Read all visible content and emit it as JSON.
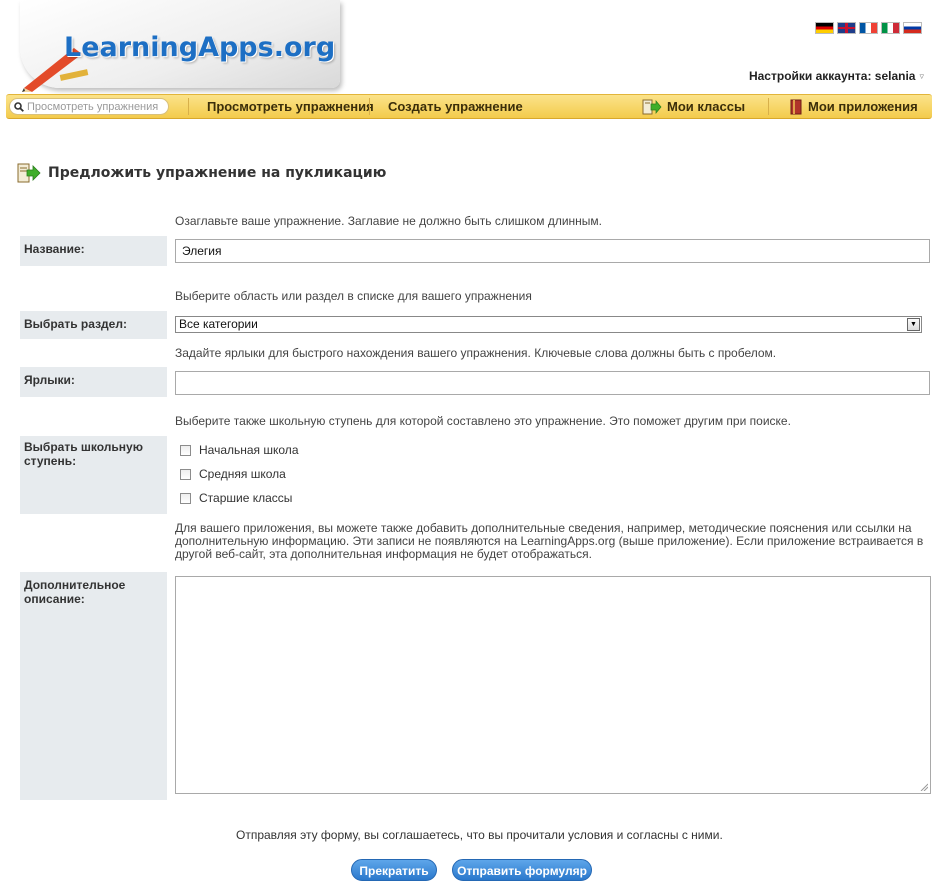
{
  "header": {
    "logo_text": "LearningApps.org",
    "account_label": "Настройки аккаунта: selania",
    "languages": [
      "de",
      "en",
      "fr",
      "it",
      "ru"
    ]
  },
  "nav": {
    "search_placeholder": "Просмотреть упражнения",
    "browse": "Просмотреть упражнения",
    "create": "Создать упражнение",
    "my_classes": "Мои классы",
    "my_apps": "Мои приложения"
  },
  "page": {
    "title": "Предложить упражнение на пукликацию"
  },
  "form": {
    "title_hint": "Озаглавьте ваше упражнение. Заглавие не должно быть слишком длинным.",
    "title_label": "Название:",
    "title_value": "Элегия",
    "category_hint": "Выберите область или раздел в списке для вашего упражнения",
    "category_label": "Выбрать раздел:",
    "category_value": "Все категории",
    "tags_hint": "Задайте ярлыки для быстрого нахождения вашего упражнения. Ключевые слова должны быть с пробелом.",
    "tags_label": "Ярлыки:",
    "tags_value": "",
    "level_hint": "Выберите также школьную ступень для которой составлено это упражнение. Это поможет другим при поиске.",
    "level_label": "Выбрать школьную ступень:",
    "levels": [
      "Начальная школа",
      "Средняя школа",
      "Старшие классы"
    ],
    "description_hint": "Для вашего приложения, вы можете также добавить дополнительные сведения, например, методические пояснения или ссылки на дополнительную информацию. Эти записи не появляются на LearningApps.org (выше приложение). Если приложение встраивается в другой веб-сайт, эта дополнительная информация не будет отображаться.",
    "description_label": "Дополнительное описание:",
    "description_value": ""
  },
  "footer": {
    "agreement": "Отправляя эту форму, вы соглашаетесь, что вы прочитали условия и согласны с ними.",
    "cancel": "Прекратить",
    "submit": "Отправить формуляр"
  },
  "colors": {
    "nav_bar": "#f3cb4c",
    "logo_blue": "#1d6fc4",
    "button_blue": "#2a78cc",
    "label_bg": "#e7ebee"
  }
}
